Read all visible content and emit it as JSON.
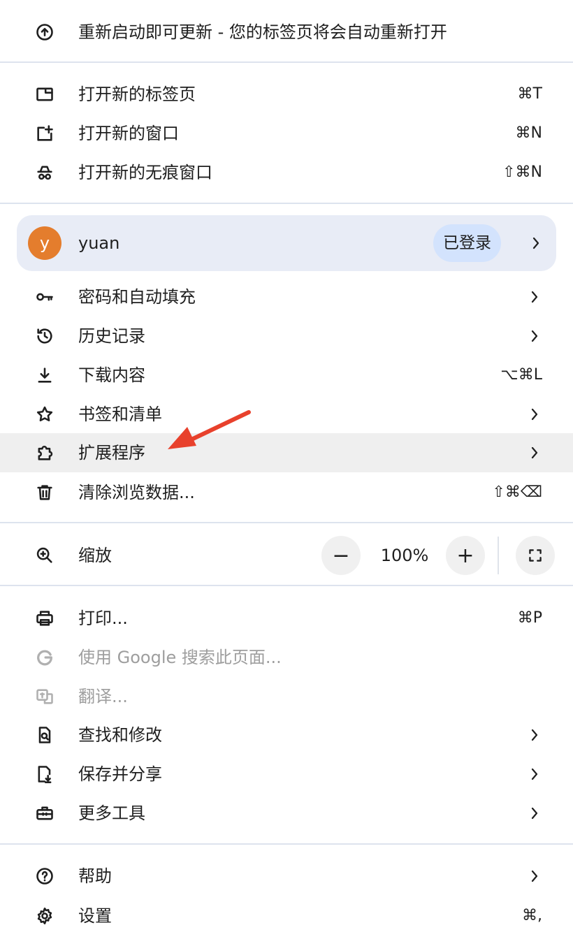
{
  "update": {
    "label": "重新启动即可更新 - 您的标签页将会自动重新打开"
  },
  "new_items": [
    {
      "label": "打开新的标签页",
      "shortcut": "⌘T"
    },
    {
      "label": "打开新的窗口",
      "shortcut": "⌘N"
    },
    {
      "label": "打开新的无痕窗口",
      "shortcut": "⇧⌘N"
    }
  ],
  "profile": {
    "avatar_letter": "y",
    "name": "yuan",
    "status": "已登录",
    "avatar_color": "#e47d2d"
  },
  "main_items": [
    {
      "label": "密码和自动填充",
      "shortcut": ""
    },
    {
      "label": "历史记录",
      "shortcut": ""
    },
    {
      "label": "下载内容",
      "shortcut": "⌥⌘L"
    },
    {
      "label": "书签和清单",
      "shortcut": ""
    },
    {
      "label": "扩展程序",
      "shortcut": ""
    },
    {
      "label": "清除浏览数据...",
      "shortcut": "⇧⌘⌫"
    }
  ],
  "zoom": {
    "label": "缩放",
    "minus": "−",
    "value": "100%",
    "plus": "+"
  },
  "tools_items": [
    {
      "label": "打印...",
      "shortcut": "⌘P"
    },
    {
      "label": "使用 Google 搜索此页面..."
    },
    {
      "label": "翻译..."
    },
    {
      "label": "查找和修改"
    },
    {
      "label": "保存并分享"
    },
    {
      "label": "更多工具"
    }
  ],
  "footer_items": [
    {
      "label": "帮助"
    },
    {
      "label": "设置",
      "shortcut": "⌘,"
    }
  ],
  "colors": {
    "annotation_arrow": "#e8412c",
    "hover_row": "#efefef",
    "profile_bg": "#e8ecf6"
  }
}
